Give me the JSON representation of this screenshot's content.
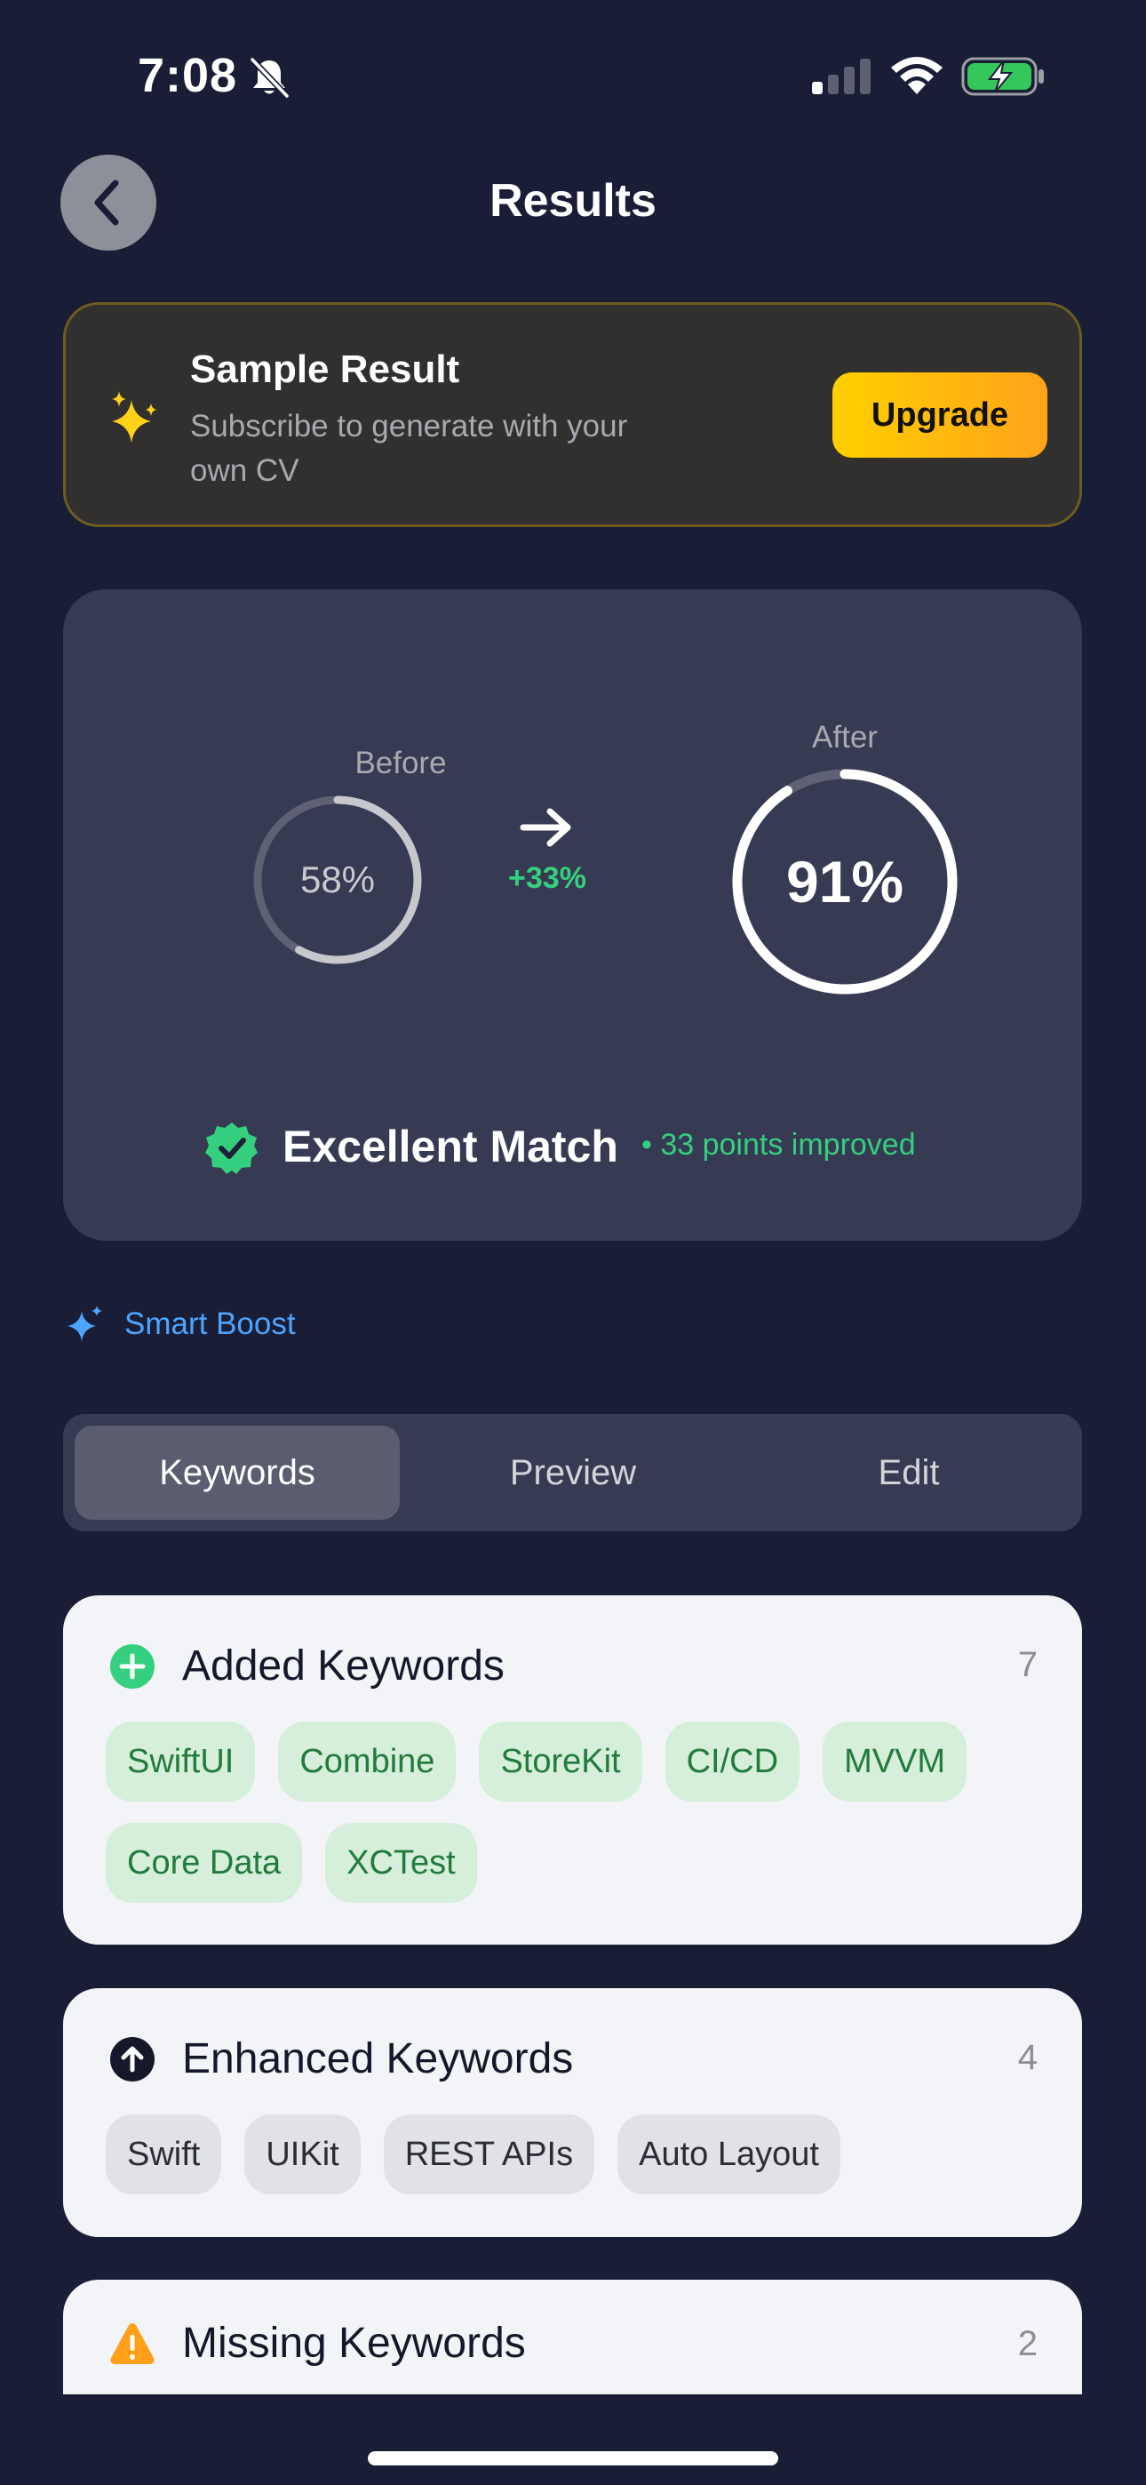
{
  "status_bar": {
    "time": "7:08"
  },
  "nav": {
    "title": "Results"
  },
  "banner": {
    "title": "Sample Result",
    "subtitle": "Subscribe to generate with your own CV",
    "button_label": "Upgrade"
  },
  "score": {
    "before_label": "Before",
    "before_value": "58%",
    "before_fraction": 0.58,
    "delta": "+33%",
    "after_label": "After",
    "after_value": "91%",
    "after_fraction": 0.91,
    "match_label": "Excellent Match",
    "improved_text": "• 33 points improved"
  },
  "smart_boost": {
    "label": "Smart Boost"
  },
  "segments": [
    {
      "label": "Keywords",
      "active": true
    },
    {
      "label": "Preview",
      "active": false
    },
    {
      "label": "Edit",
      "active": false
    }
  ],
  "added_keywords": {
    "title": "Added Keywords",
    "count": "7",
    "items": [
      "SwiftUI",
      "Combine",
      "StoreKit",
      "CI/CD",
      "MVVM",
      "Core Data",
      "XCTest"
    ]
  },
  "enhanced_keywords": {
    "title": "Enhanced Keywords",
    "count": "4",
    "items": [
      "Swift",
      "UIKit",
      "REST APIs",
      "Auto Layout"
    ]
  },
  "missing_keywords": {
    "title": "Missing Keywords",
    "count": "2"
  },
  "colors": {
    "background": "#191d35",
    "card": "#363a52",
    "accent_green": "#35d07f",
    "accent_blue": "#4ea5ff",
    "upgrade_gradient_start": "#ffd000",
    "upgrade_gradient_end": "#ffa31a",
    "warning": "#ff9f1a"
  }
}
